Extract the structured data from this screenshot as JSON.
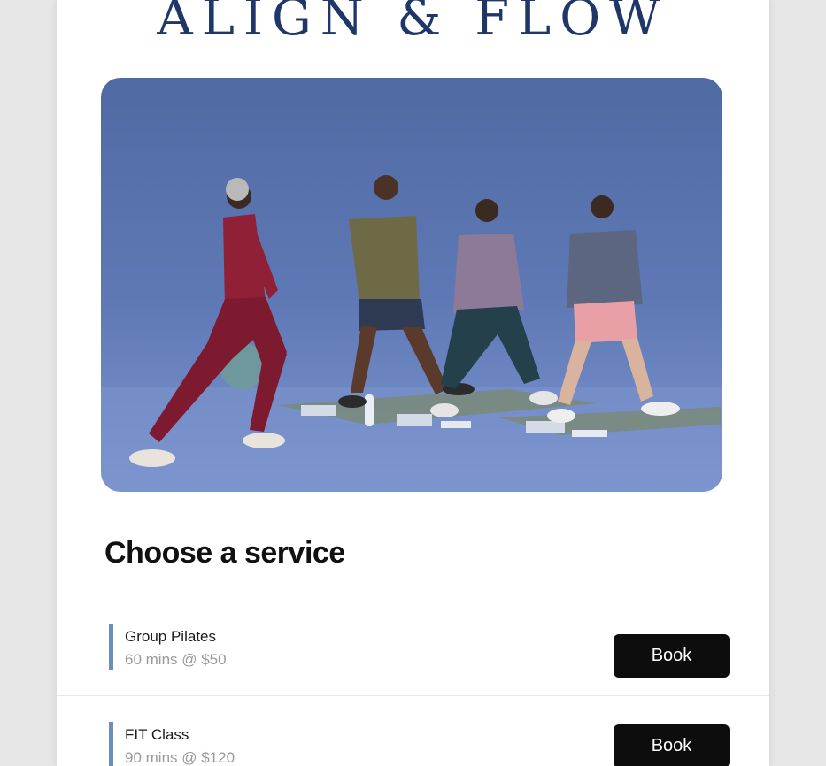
{
  "brand": {
    "name": "ALIGN & FLOW"
  },
  "hero": {
    "image": "people-stretching-lunges-photo"
  },
  "section": {
    "title": "Choose a service"
  },
  "services": [
    {
      "name": "Group Pilates",
      "meta": "60 mins @ $50",
      "button": "Book"
    },
    {
      "name": "FIT Class",
      "meta": "90 mins @ $120",
      "button": "Book"
    }
  ],
  "colors": {
    "brand": "#1f3669",
    "accent_bar": "#6a8fbf",
    "button_bg": "#0d0d0d",
    "button_text": "#ffffff"
  }
}
